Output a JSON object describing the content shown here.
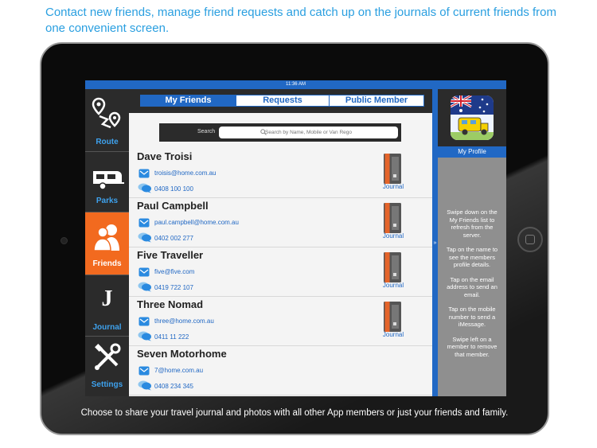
{
  "headline": "Contact new friends, manage friend requests  and catch up on the journals of current friends from one convenient screen.",
  "status_time": "11:36 AM",
  "nav": [
    {
      "label": "Route",
      "icon": "route-icon"
    },
    {
      "label": "Parks",
      "icon": "caravan-icon"
    },
    {
      "label": "Friends",
      "icon": "friends-icon"
    },
    {
      "label": "Journal",
      "icon": "journal-letter-icon"
    },
    {
      "label": "Settings",
      "icon": "tools-icon"
    }
  ],
  "tabs": [
    {
      "label": "My Friends",
      "selected": true
    },
    {
      "label": "Requests",
      "selected": false
    },
    {
      "label": "Public Member",
      "selected": false
    }
  ],
  "search": {
    "label": "Search",
    "placeholder": "Search by Name, Mobile or Van Rego"
  },
  "friends": [
    {
      "name": "Dave Troisi",
      "email": "troisis@home.com.au",
      "phone": "0408 100 100",
      "journal": "Journal"
    },
    {
      "name": "Paul Campbell",
      "email": "paul.campbell@home.com.au",
      "phone": "0402 002 277",
      "journal": "Journal"
    },
    {
      "name": "Five Traveller",
      "email": "five@five.com",
      "phone": "0419 722 107",
      "journal": "Journal"
    },
    {
      "name": "Three Nomad",
      "email": "three@home.com.au",
      "phone": "0411 11 222",
      "journal": "Journal"
    },
    {
      "name": "Seven Motorhome",
      "email": "7@home.com.au",
      "phone": "0408 234 345",
      "journal": ""
    }
  ],
  "divider_glyph": "»",
  "profile": {
    "label": "My Profile"
  },
  "tips": [
    "Swipe down on the My Friends list to refresh from the server.",
    "Tap on the name to see the members profile details.",
    "Tap on the email address to send an email.",
    "Tap on the mobile number to send a iMessage.",
    "Swipe left on a member to remove that member."
  ],
  "caption": "Choose to share your travel journal and photos with all other App members or just your friends and family.",
  "colors": {
    "accent_blue": "#2168c4",
    "link_blue": "#3ea2ee",
    "active_orange": "#f26a1f",
    "headline_blue": "#2a9fe0"
  }
}
